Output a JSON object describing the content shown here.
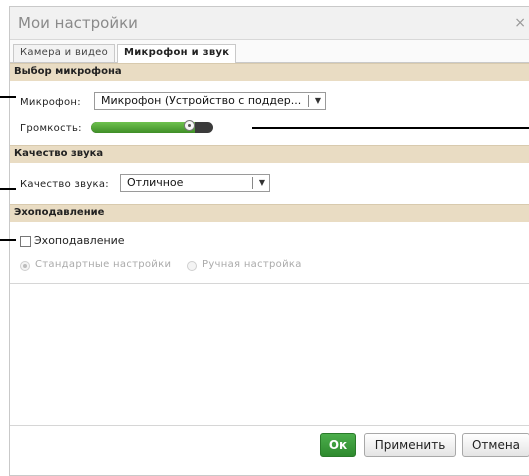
{
  "window": {
    "title": "Мои настройки",
    "close_glyph": "×"
  },
  "tabs": [
    {
      "label": "Камера и видео",
      "active": false
    },
    {
      "label": "Микрофон и звук",
      "active": true
    }
  ],
  "microphone": {
    "section_title": "Выбор микрофона",
    "label": "Микрофон:",
    "value": "Микрофон (Устройство с поддер..."
  },
  "volume": {
    "label": "Громкость:",
    "level_fraction": 0.85
  },
  "quality": {
    "section_title": "Качество звука",
    "label": "Качество звука:",
    "value": "Отличное"
  },
  "echo": {
    "section_title": "Эхоподавление",
    "checkbox_label": "Эхоподавление",
    "checked": false,
    "options": [
      {
        "label": "Стандартные настройки",
        "selected": true
      },
      {
        "label": "Ручная настройка",
        "selected": false
      }
    ]
  },
  "buttons": {
    "ok": "Ок",
    "apply": "Применить",
    "cancel": "Отмена"
  },
  "colors": {
    "section_bg": "#e9dcc3",
    "ok_green": "#3d9b3d",
    "volume_green": "#4fa935"
  }
}
